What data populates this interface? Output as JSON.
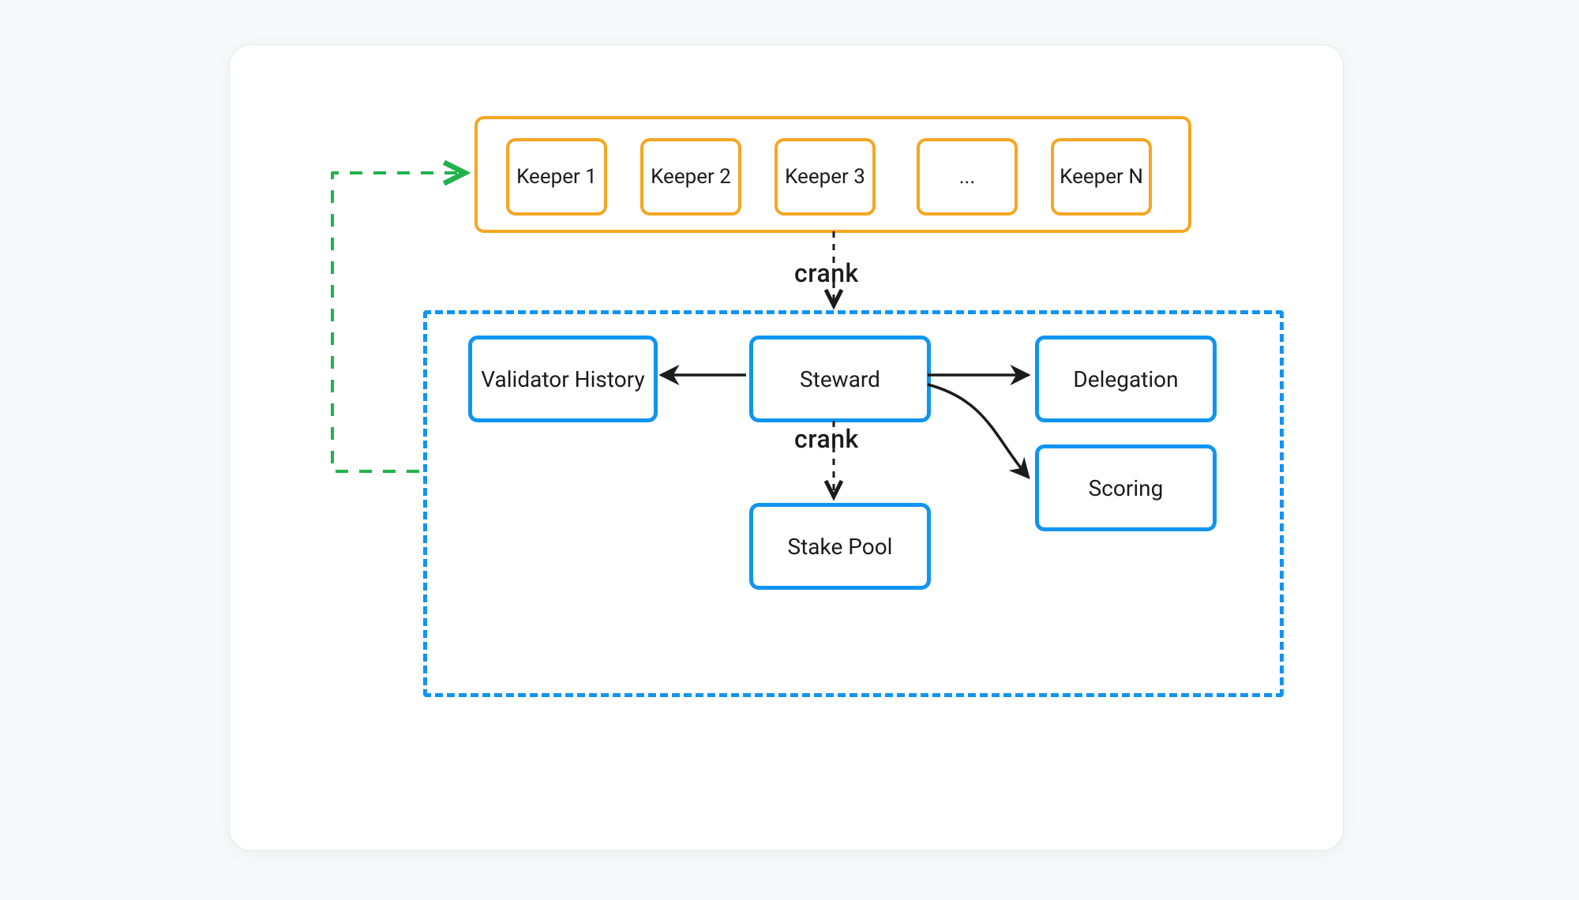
{
  "keepers": {
    "items": [
      {
        "label": "Keeper 1"
      },
      {
        "label": "Keeper 2"
      },
      {
        "label": "Keeper 3"
      },
      {
        "label": "..."
      },
      {
        "label": "Keeper N"
      }
    ]
  },
  "edges": {
    "crank_top": "crank",
    "crank_bottom": "crank"
  },
  "blue": {
    "validator_history": "Validator History",
    "steward": "Steward",
    "delegation": "Delegation",
    "scoring": "Scoring",
    "stake_pool": "Stake Pool"
  },
  "colors": {
    "orange": "#f5a623",
    "blue": "#1094f2",
    "green": "#22b24c",
    "text": "#1b1b1b"
  }
}
